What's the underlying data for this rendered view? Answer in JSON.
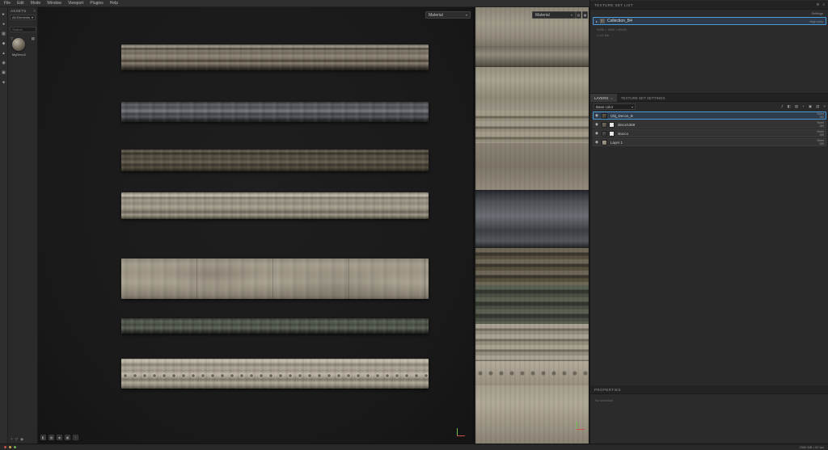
{
  "app": {
    "accent_color": "#4f9bd5",
    "viewport_bg": "#1a1a1a"
  },
  "glyphs": {
    "caret": "▾",
    "close": "×"
  },
  "menubar": {
    "items": [
      "File",
      "Edit",
      "Mode",
      "Window",
      "Viewport",
      "Plugins",
      "Help"
    ]
  },
  "left_toolbar": {
    "icons": [
      {
        "name": "select-tool",
        "glyph": "►"
      },
      {
        "name": "paint-tool",
        "glyph": "●"
      },
      {
        "name": "eraser-tool",
        "glyph": "▦"
      },
      {
        "name": "projection-tool",
        "glyph": "◆"
      },
      {
        "name": "polygon-fill-tool",
        "glyph": "▲"
      },
      {
        "name": "smudge-tool",
        "glyph": "◉"
      },
      {
        "name": "clone-tool",
        "glyph": "▣"
      },
      {
        "name": "material-picker-tool",
        "glyph": "◈"
      }
    ]
  },
  "assets": {
    "title": "ASSETS",
    "category": "All Elements",
    "search_placeholder": "Search",
    "filter_glyph": "▽",
    "view_glyph": "▦",
    "material_label": "MyDeco2",
    "footer_icons": [
      {
        "name": "import-assets",
        "glyph": "+"
      },
      {
        "name": "filter-assets",
        "glyph": "▽"
      },
      {
        "name": "asset-info",
        "glyph": "◉"
      }
    ]
  },
  "viewport3d": {
    "shading_mode": "Material",
    "toolbar_icons": [
      {
        "name": "camera-settings",
        "glyph": "◧"
      },
      {
        "name": "display-settings",
        "glyph": "▦"
      },
      {
        "name": "environment",
        "glyph": "◉"
      },
      {
        "name": "shadows-toggle",
        "glyph": "▣"
      },
      {
        "name": "viewport-menu",
        "glyph": "≡"
      }
    ]
  },
  "viewport2d": {
    "shading_mode": "Material",
    "buttons": [
      {
        "name": "uv-padding-toggle",
        "glyph": "▤"
      },
      {
        "name": "tiling-toggle",
        "glyph": "▣"
      }
    ]
  },
  "texture_set_list": {
    "title": "TEXTURE SET LIST",
    "header_icons": [
      {
        "name": "gear-icon",
        "glyph": "⚙"
      },
      {
        "name": "menu-icon",
        "glyph": "≡"
      }
    ],
    "settings_label": "Settings",
    "expander_glyph": "▸",
    "set_name": "Collection_B4",
    "set_detail": "High poly",
    "meta_line1": "4096 × 4096 • sRGB",
    "meta_line2": "1 UV tile"
  },
  "layers_panel": {
    "tab_layers": "LAYERS",
    "tab_settings": "TEXTURE SET SETTINGS",
    "channel_filter": "Base color",
    "eye_glyph": "◉",
    "toolbar_icons": [
      {
        "name": "add-effect",
        "glyph": "ƒ"
      },
      {
        "name": "add-mask",
        "glyph": "◧"
      },
      {
        "name": "add-fill-layer",
        "glyph": "▨"
      },
      {
        "name": "add-paint-layer",
        "glyph": "+"
      },
      {
        "name": "add-group",
        "glyph": "▣"
      },
      {
        "name": "add-smart-material",
        "glyph": "▤"
      },
      {
        "name": "delete-layer",
        "glyph": "×"
      }
    ],
    "layers": [
      {
        "name": "Obj_Decos_B",
        "blend": "Norm",
        "opacity": "100"
      },
      {
        "name": "decor1369",
        "blend": "Norm",
        "opacity": "100"
      },
      {
        "name": "stucco",
        "blend": "Norm",
        "opacity": "100"
      },
      {
        "name": "Layer 1",
        "blend": "Norm",
        "opacity": "100"
      }
    ]
  },
  "properties": {
    "title": "PROPERTIES",
    "empty_text": "No selection"
  },
  "statusbar": {
    "right_text": "2980 MB  •  60 fps"
  }
}
